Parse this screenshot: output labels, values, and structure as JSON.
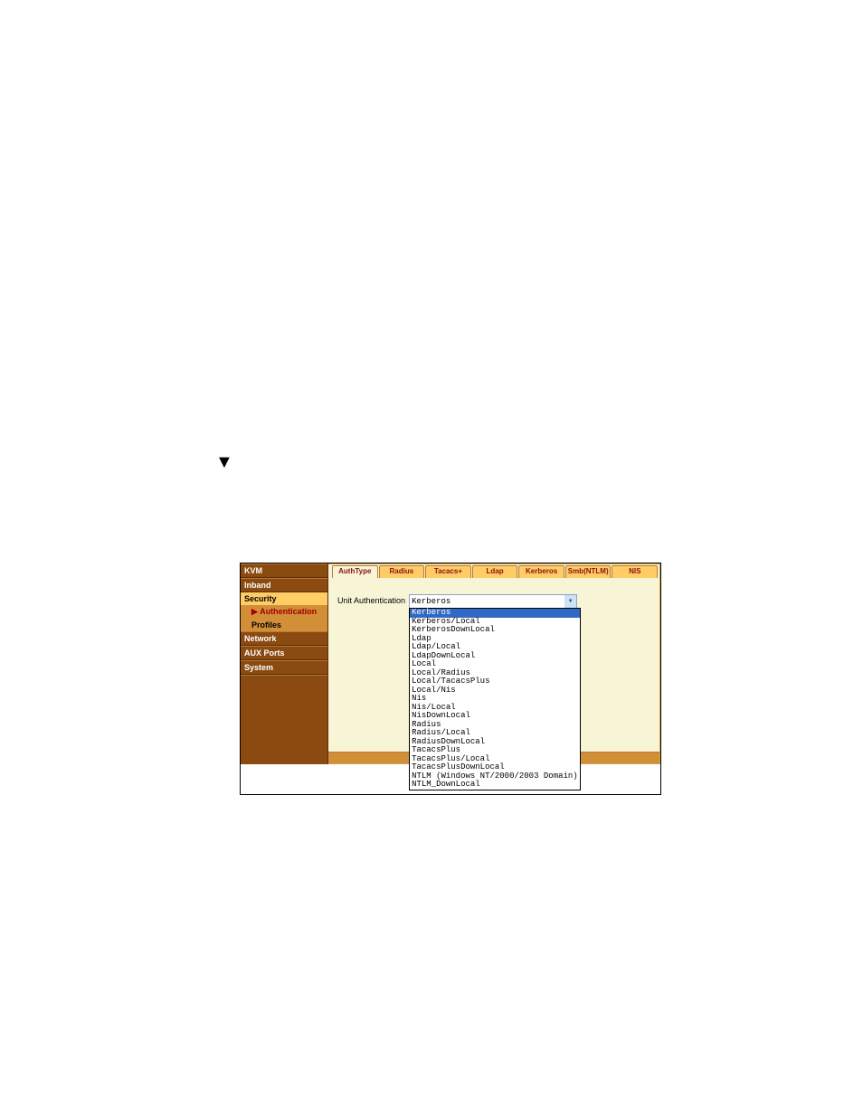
{
  "sidebar": {
    "items": [
      {
        "label": "KVM"
      },
      {
        "label": "Inband"
      },
      {
        "label": "Security",
        "group_head": true
      },
      {
        "label": "Authentication",
        "group_item": true,
        "selected": true
      },
      {
        "label": "Profiles",
        "group_item": true
      },
      {
        "label": "Network"
      },
      {
        "label": "AUX Ports"
      },
      {
        "label": "System"
      }
    ]
  },
  "tabs": [
    {
      "label": "AuthType",
      "active": true
    },
    {
      "label": "Radius"
    },
    {
      "label": "Tacacs+"
    },
    {
      "label": "Ldap"
    },
    {
      "label": "Kerberos"
    },
    {
      "label": "Smb(NTLM)"
    },
    {
      "label": "NIS"
    }
  ],
  "field": {
    "label": "Unit Authentication",
    "value": "Kerberos"
  },
  "options": [
    {
      "label": "Kerberos",
      "highlight": true
    },
    {
      "label": "Kerberos/Local"
    },
    {
      "label": "KerberosDownLocal"
    },
    {
      "label": "Ldap"
    },
    {
      "label": "Ldap/Local"
    },
    {
      "label": "LdapDownLocal"
    },
    {
      "label": "Local"
    },
    {
      "label": "Local/Radius"
    },
    {
      "label": "Local/TacacsPlus"
    },
    {
      "label": "Local/Nis"
    },
    {
      "label": "Nis"
    },
    {
      "label": "Nis/Local"
    },
    {
      "label": "NisDownLocal"
    },
    {
      "label": "Radius"
    },
    {
      "label": "Radius/Local"
    },
    {
      "label": "RadiusDownLocal"
    },
    {
      "label": "TacacsPlus"
    },
    {
      "label": "TacacsPlus/Local"
    },
    {
      "label": "TacacsPlusDownLocal"
    },
    {
      "label": "NTLM (Windows NT/2000/2003 Domain)"
    },
    {
      "label": "NTLM_DownLocal"
    }
  ]
}
